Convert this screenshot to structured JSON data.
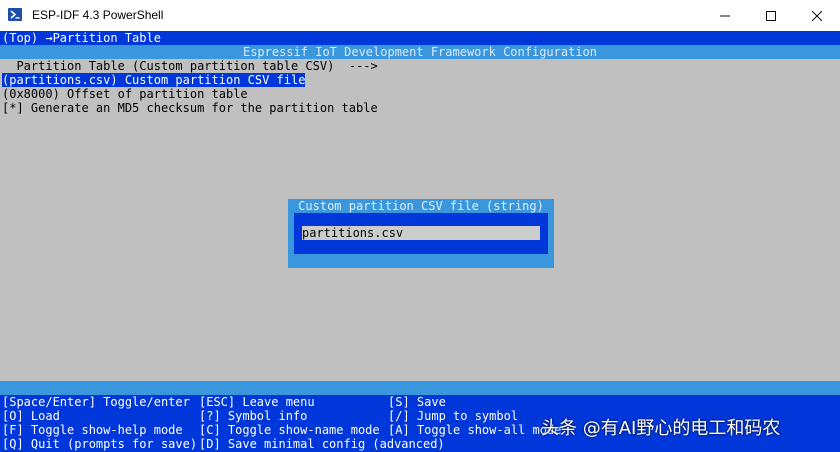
{
  "window": {
    "title": "ESP-IDF 4.3 PowerShell",
    "icon": "powershell-icon"
  },
  "window_controls": {
    "minimize": "—",
    "maximize": "☐",
    "close": "✕"
  },
  "breadcrumb": "(Top) →Partition Table",
  "header": "Espressif IoT Development Framework Configuration",
  "menu": {
    "items": [
      "  Partition Table (Custom partition table CSV)  --->",
      "(partitions.csv) Custom partition CSV file",
      "(0x8000) Offset of partition table",
      "[*] Generate an MD5 checksum for the partition table"
    ],
    "selected_index": 1
  },
  "dialog": {
    "title": "Custom partition CSV file (string)",
    "value": "partitions.csv"
  },
  "help": [
    [
      "[Space/Enter] Toggle/enter",
      "[ESC] Leave menu",
      "[S] Save"
    ],
    [
      "[O] Load",
      "[?] Symbol info",
      "[/] Jump to symbol"
    ],
    [
      "[F] Toggle show-help mode",
      "[C] Toggle show-name mode",
      "[A] Toggle show-all mode"
    ],
    [
      "[Q] Quit (prompts for save)",
      "[D] Save minimal config (advanced)",
      ""
    ]
  ],
  "watermark": "头条 @有AI野心的电工和码农",
  "colors": {
    "terminal_bg": "#c0c0c0",
    "blue": "#0037da",
    "light_blue": "#3a96dd"
  }
}
